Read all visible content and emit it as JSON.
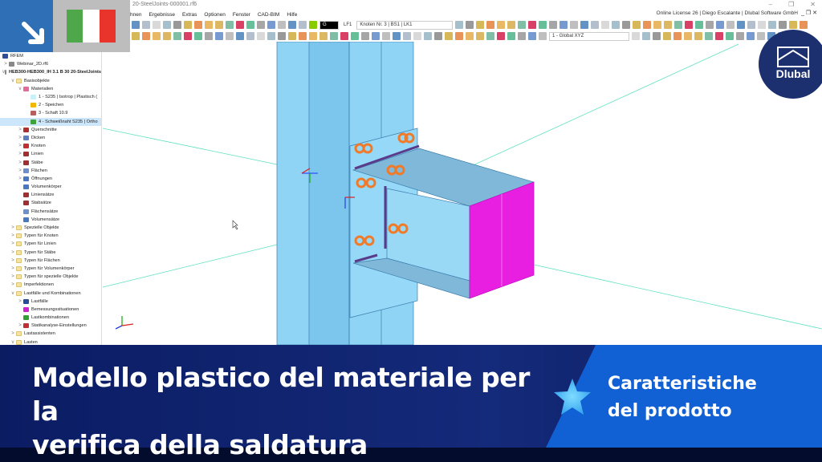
{
  "window": {
    "title": "20-SteelJoints-000001.rf6",
    "license": "Online License 26 | Diego Escalante | Dlubal Software GmbH"
  },
  "menu": [
    "hnen",
    "Ergebnisse",
    "Extras",
    "Optionen",
    "Fenster",
    "CAD-BIM",
    "Hilfe"
  ],
  "toolbar": {
    "loadcase_code": "LF1",
    "loadcase_label": "Knoten Nr. 3 | BS1 | LK1",
    "coord_system": "1 - Global XYZ",
    "color_g": "G"
  },
  "navigator": {
    "root": "RFEM",
    "items": [
      {
        "label": "Webinar_2D.rf6",
        "level": 0,
        "chev": ">"
      },
      {
        "label": "HEB300-HEB300_IH 3.1 B 30 20-SteelJoints",
        "level": 0,
        "chev": "v",
        "bold": true
      },
      {
        "label": "Basisobjekte",
        "level": 1,
        "chev": "v",
        "folder": true
      },
      {
        "label": "Materialien",
        "level": 2,
        "chev": "v",
        "color": "#e26b9b"
      },
      {
        "label": "1 - S235 | Isotrop | Plastisch (",
        "level": 3,
        "color": "#c8f2f8"
      },
      {
        "label": "2 - Speichen",
        "level": 3,
        "color": "#f1b800"
      },
      {
        "label": "3 - Schaft 10.9",
        "level": 3,
        "color": "#b56060"
      },
      {
        "label": "4 - Schweißnaht S235 | Ortho",
        "level": 3,
        "color": "#3fa23f",
        "selected": true
      },
      {
        "label": "Querschnitte",
        "level": 2,
        "chev": ">",
        "color": "#b03030"
      },
      {
        "label": "Dicken",
        "level": 2,
        "chev": ">",
        "color": "#5b7fbf"
      },
      {
        "label": "Knoten",
        "level": 2,
        "chev": ">",
        "color": "#c03030"
      },
      {
        "label": "Linien",
        "level": 2,
        "chev": ">",
        "color": "#a03030"
      },
      {
        "label": "Stäbe",
        "level": 2,
        "chev": ">",
        "color": "#a03030"
      },
      {
        "label": "Flächen",
        "level": 2,
        "chev": ">",
        "color": "#6d8fcc"
      },
      {
        "label": "Öffnungen",
        "level": 2,
        "chev": ">",
        "color": "#4a78c0"
      },
      {
        "label": "Volumenkörper",
        "level": 2,
        "color": "#4a78c0"
      },
      {
        "label": "Liniensätze",
        "level": 2,
        "color": "#a03030"
      },
      {
        "label": "Stabsätze",
        "level": 2,
        "color": "#a03030"
      },
      {
        "label": "Flächensätze",
        "level": 2,
        "color": "#6d8fcc"
      },
      {
        "label": "Volumensätze",
        "level": 2,
        "color": "#4a78c0"
      },
      {
        "label": "Spezielle Objekte",
        "level": 1,
        "chev": ">",
        "folder": true
      },
      {
        "label": "Typen für Knoten",
        "level": 1,
        "chev": ">",
        "folder": true
      },
      {
        "label": "Typen für Linien",
        "level": 1,
        "chev": ">",
        "folder": true
      },
      {
        "label": "Typen für Stäbe",
        "level": 1,
        "chev": ">",
        "folder": true
      },
      {
        "label": "Typen für Flächen",
        "level": 1,
        "chev": ">",
        "folder": true
      },
      {
        "label": "Typen für Volumenkörper",
        "level": 1,
        "chev": ">",
        "folder": true
      },
      {
        "label": "Typen für spezielle Objekte",
        "level": 1,
        "chev": ">",
        "folder": true
      },
      {
        "label": "Imperfektionen",
        "level": 1,
        "chev": ">",
        "folder": true
      },
      {
        "label": "Lastfälle und Kombinationen",
        "level": 1,
        "chev": "v",
        "folder": true
      },
      {
        "label": "Lastfälle",
        "level": 2,
        "chev": ">",
        "color": "#2a4a9a"
      },
      {
        "label": "Bemessungssituationen",
        "level": 2,
        "color": "#d020d0"
      },
      {
        "label": "Lastkombinationen",
        "level": 2,
        "color": "#30a030"
      },
      {
        "label": "Statikanalyse-Einstellungen",
        "level": 2,
        "chev": ">",
        "color": "#c03030"
      },
      {
        "label": "Lastassistenten",
        "level": 1,
        "chev": ">",
        "folder": true
      },
      {
        "label": "Lasten",
        "level": 1,
        "chev": "v",
        "folder": true
      }
    ]
  },
  "axes": {
    "x": "X",
    "y": "Y",
    "z": "Z"
  },
  "banner": {
    "headline_1": "Modello plastico del materiale per la",
    "headline_2": "verifica della saldatura",
    "category_1": "Caratteristiche",
    "category_2": "del prodotto"
  },
  "logo": {
    "text": "Dlubal"
  },
  "colors": {
    "accent": "#1160d4",
    "navy": "#0b1c63",
    "magenta": "#e81ee0",
    "steel": "#8fd3f5",
    "flag_green": "#4ea84a",
    "flag_white": "#ffffff",
    "flag_red": "#e8342a"
  }
}
